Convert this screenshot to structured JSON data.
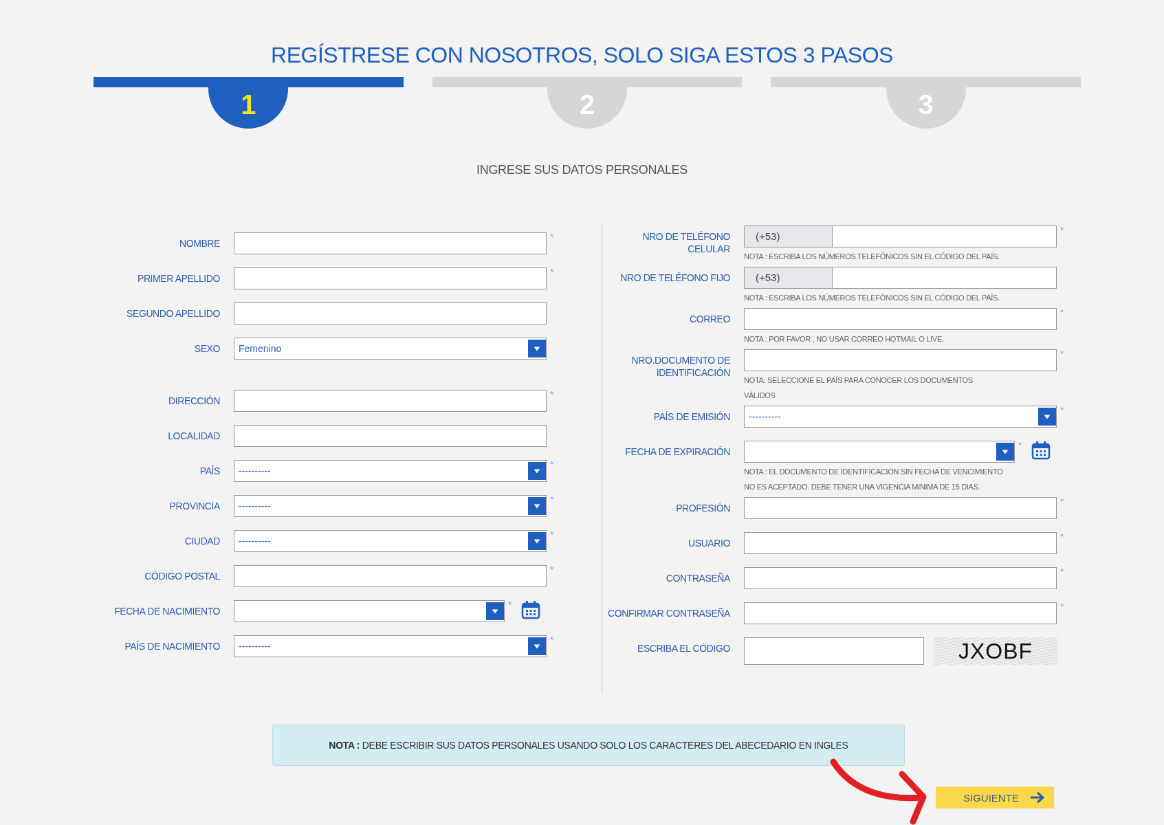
{
  "title": "REGÍSTRESE CON NOSOTROS, SOLO SIGA ESTOS 3 PASOS",
  "steps": [
    {
      "number": "1",
      "selected": true
    },
    {
      "number": "2",
      "selected": false
    },
    {
      "number": "3",
      "selected": false
    }
  ],
  "section_heading": "INGRESE SUS DATOS PERSONALES",
  "left_groups": [
    [
      {
        "kind": "text",
        "label": "NOMBRE",
        "marker": "*"
      },
      {
        "kind": "text",
        "label": "PRIMER APELLIDO",
        "marker": "*"
      },
      {
        "kind": "text",
        "label": "SEGUNDO APELLIDO"
      },
      {
        "kind": "select",
        "label": "SEXO",
        "value": "Femenino"
      }
    ],
    [
      {
        "kind": "text",
        "label": "DIRECCIÓN",
        "marker": "*"
      },
      {
        "kind": "text",
        "label": "LOCALIDAD"
      },
      {
        "kind": "select",
        "label": "PAÍS",
        "value": "----------",
        "marker": "*"
      },
      {
        "kind": "select",
        "label": "PROVINCIA",
        "value": "----------",
        "marker": "*"
      },
      {
        "kind": "select",
        "label": "CIUDAD",
        "value": "----------",
        "marker": "*"
      },
      {
        "kind": "text",
        "label": "CÓDIGO POSTAL",
        "marker": "*"
      },
      {
        "kind": "date",
        "label": "FECHA DE NACIMIENTO",
        "marker": "*"
      },
      {
        "kind": "select",
        "label": "PAÍS DE NACIMIENTO",
        "value": "----------",
        "marker": "*"
      }
    ]
  ],
  "right_fields": [
    {
      "kind": "phone",
      "label": "NRO DE TELÉFONO CELULAR",
      "prefix": "(+53)",
      "marker": "*",
      "note": "NOTA : ESCRIBA LOS NÚMEROS TELEFÓNICOS SIN EL CÓDIGO DEL PAÍS."
    },
    {
      "kind": "phone",
      "label": "NRO DE TELÉFONO FIJO",
      "prefix": "(+53)",
      "note": "NOTA : ESCRIBA LOS NÚMEROS TELEFÓNICOS SIN EL CÓDIGO DEL PAÍS."
    },
    {
      "kind": "text",
      "label": "CORREO",
      "marker": "*",
      "note": "NOTA : POR FAVOR , NO USAR CORREO HOTMAIL O LIVE."
    },
    {
      "kind": "text",
      "label": "NRO.DOCUMENTO DE IDENTIFICACIÓN",
      "marker": "*",
      "note": "NOTA: SELECCIONE EL PAÍS PARA CONOCER LOS DOCUMENTOS VÁLIDOS"
    },
    {
      "kind": "select",
      "label": "PAÍS DE EMISIÓN",
      "value": "----------",
      "marker": "*"
    },
    {
      "kind": "date",
      "label": "FECHA DE EXPIRACIÓN",
      "marker": "*",
      "note": "NOTA : EL DOCUMENTO DE IDENTIFICACION SIN FECHA DE VENCIMIENTO NO ES ACEPTADO. DEBE TENER UNA VIGENCIA MINIMA DE 15 DIAS."
    },
    {
      "kind": "text",
      "label": "PROFESIÓN",
      "marker": "*"
    },
    {
      "kind": "text",
      "label": "USUARIO",
      "marker": "*"
    },
    {
      "kind": "text",
      "label": "CONTRASEÑA",
      "marker": "*"
    },
    {
      "kind": "text",
      "label": "CONFIRMAR CONTRASEÑA",
      "marker": "*"
    },
    {
      "kind": "captcha",
      "label": "ESCRIBA EL CÓDIGO",
      "code": "JXOBF"
    }
  ],
  "notice": "**NOTA :** DEBE ESCRIBIR SUS DATOS PERSONALES USANDO SOLO LOS CARACTERES DEL ABECEDARIO EN INGLES",
  "next_button": "SIGUIENTE"
}
